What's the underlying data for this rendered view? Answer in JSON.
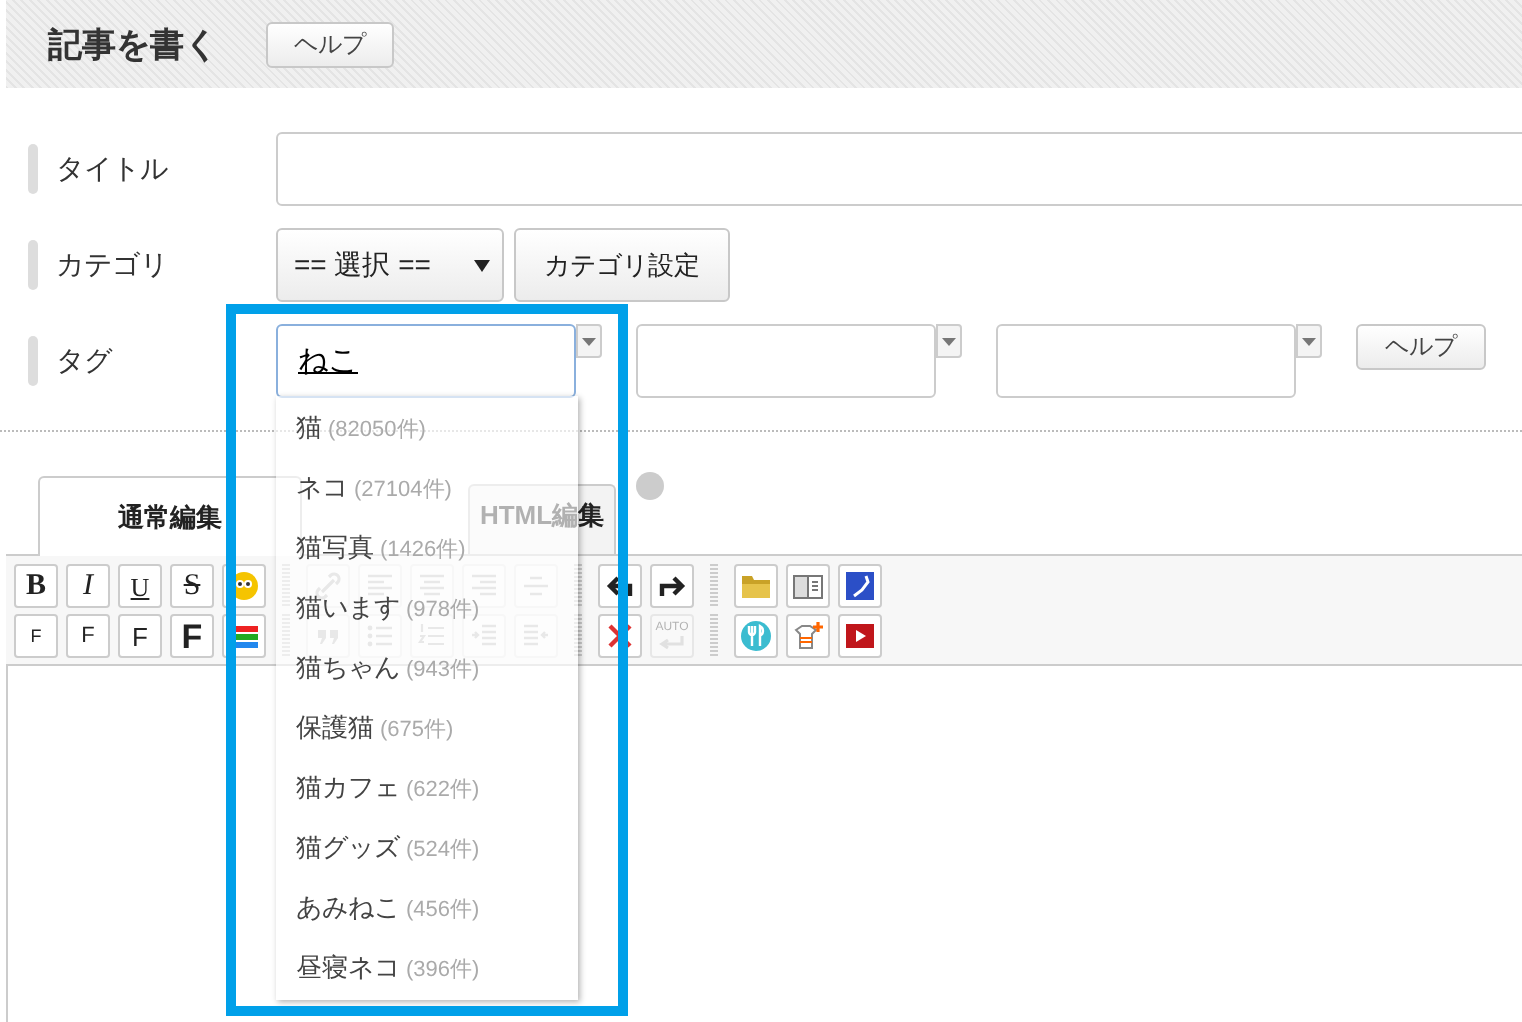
{
  "header": {
    "title": "記事を書く",
    "help_button": "ヘルプ"
  },
  "form": {
    "title_label": "タイトル",
    "category_label": "カテゴリ",
    "category_select": "== 選択 ==",
    "category_button": "カテゴリ設定",
    "tag_label": "タグ",
    "tag_value": "ねこ",
    "tag_help": "ヘルプ"
  },
  "suggestions": [
    {
      "name": "猫",
      "count": "(82050件)"
    },
    {
      "name": "ネコ",
      "count": "(27104件)"
    },
    {
      "name": "猫写真",
      "count": "(1426件)"
    },
    {
      "name": "猫います",
      "count": "(978件)"
    },
    {
      "name": "猫ちゃん",
      "count": "(943件)"
    },
    {
      "name": "保護猫",
      "count": "(675件)"
    },
    {
      "name": "猫カフェ",
      "count": "(622件)"
    },
    {
      "name": "猫グッズ",
      "count": "(524件)"
    },
    {
      "name": "あみねこ",
      "count": "(456件)"
    },
    {
      "name": "昼寝ネコ",
      "count": "(396件)"
    }
  ],
  "tabs": [
    {
      "label": "通常編集",
      "selected": true
    },
    {
      "label": "HTML編集",
      "selected": false
    }
  ],
  "toolbar": [
    [
      {
        "kind": "bold",
        "label": "B",
        "disabled": false
      },
      {
        "kind": "italic",
        "label": "I",
        "disabled": false
      },
      {
        "kind": "underline",
        "label": "U",
        "disabled": false
      },
      {
        "kind": "strike",
        "label": "S",
        "disabled": false
      },
      {
        "kind": "emoji",
        "disabled": false
      },
      {
        "kind": "separator"
      },
      {
        "kind": "link",
        "disabled": true
      },
      {
        "kind": "align-left",
        "disabled": true
      },
      {
        "kind": "align-center",
        "disabled": true
      },
      {
        "kind": "align-right",
        "disabled": true
      },
      {
        "kind": "rule",
        "disabled": true
      },
      {
        "kind": "separator"
      },
      {
        "kind": "undo",
        "disabled": false
      },
      {
        "kind": "redo",
        "disabled": false
      },
      {
        "kind": "separator"
      },
      {
        "kind": "folder",
        "disabled": false
      },
      {
        "kind": "book",
        "disabled": false
      },
      {
        "kind": "map",
        "disabled": false
      }
    ],
    [
      {
        "kind": "font-xs",
        "label": "F",
        "disabled": false
      },
      {
        "kind": "font-s",
        "label": "F",
        "disabled": false
      },
      {
        "kind": "font-m",
        "label": "F",
        "disabled": false
      },
      {
        "kind": "font-l",
        "label": "F",
        "disabled": false
      },
      {
        "kind": "color",
        "disabled": false
      },
      {
        "kind": "separator"
      },
      {
        "kind": "quote",
        "disabled": true
      },
      {
        "kind": "bullet-list",
        "disabled": true
      },
      {
        "kind": "numbered-list",
        "disabled": true
      },
      {
        "kind": "indent",
        "disabled": true
      },
      {
        "kind": "outdent",
        "disabled": true
      },
      {
        "kind": "separator"
      },
      {
        "kind": "delete",
        "disabled": false
      },
      {
        "kind": "auto",
        "label": "AUTO",
        "disabled": true
      },
      {
        "kind": "separator"
      },
      {
        "kind": "fork",
        "disabled": false
      },
      {
        "kind": "shirt",
        "disabled": false
      },
      {
        "kind": "video",
        "disabled": false
      }
    ]
  ]
}
